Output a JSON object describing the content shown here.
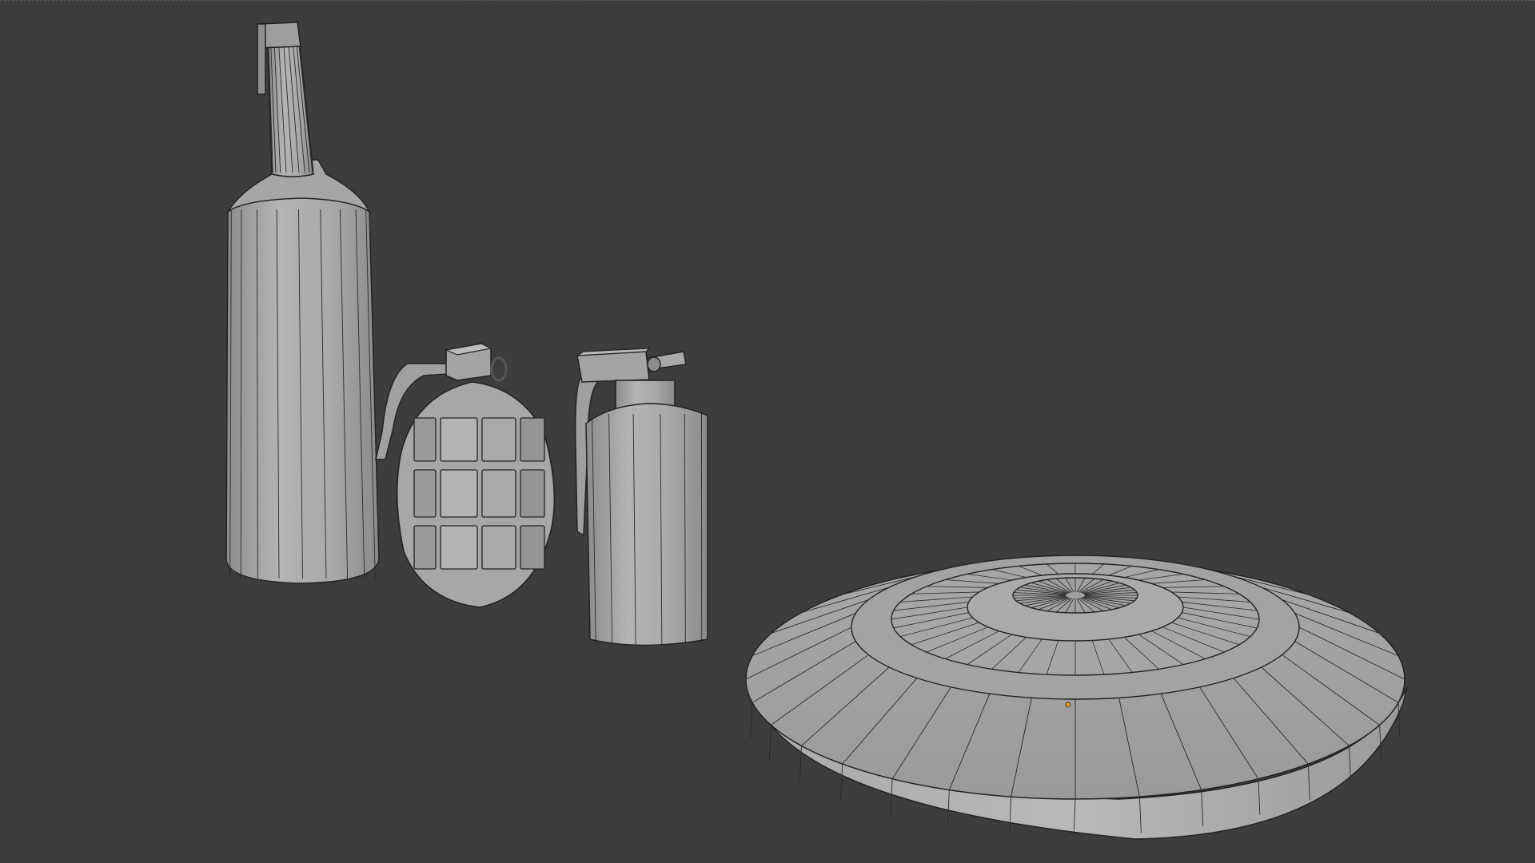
{
  "viewport": {
    "background": "#3d3d3d",
    "wire_color": "#1a1a1a",
    "solid_light": "#b0b0b0",
    "solid_mid": "#9c9c9c",
    "solid_dark": "#8a8a8a",
    "origin_color": "#f0a030"
  },
  "objects": [
    {
      "name": "bottle",
      "kind": "mesh"
    },
    {
      "name": "frag-grenade",
      "kind": "mesh"
    },
    {
      "name": "smoke-grenade",
      "kind": "mesh"
    },
    {
      "name": "landmine",
      "kind": "mesh"
    }
  ]
}
